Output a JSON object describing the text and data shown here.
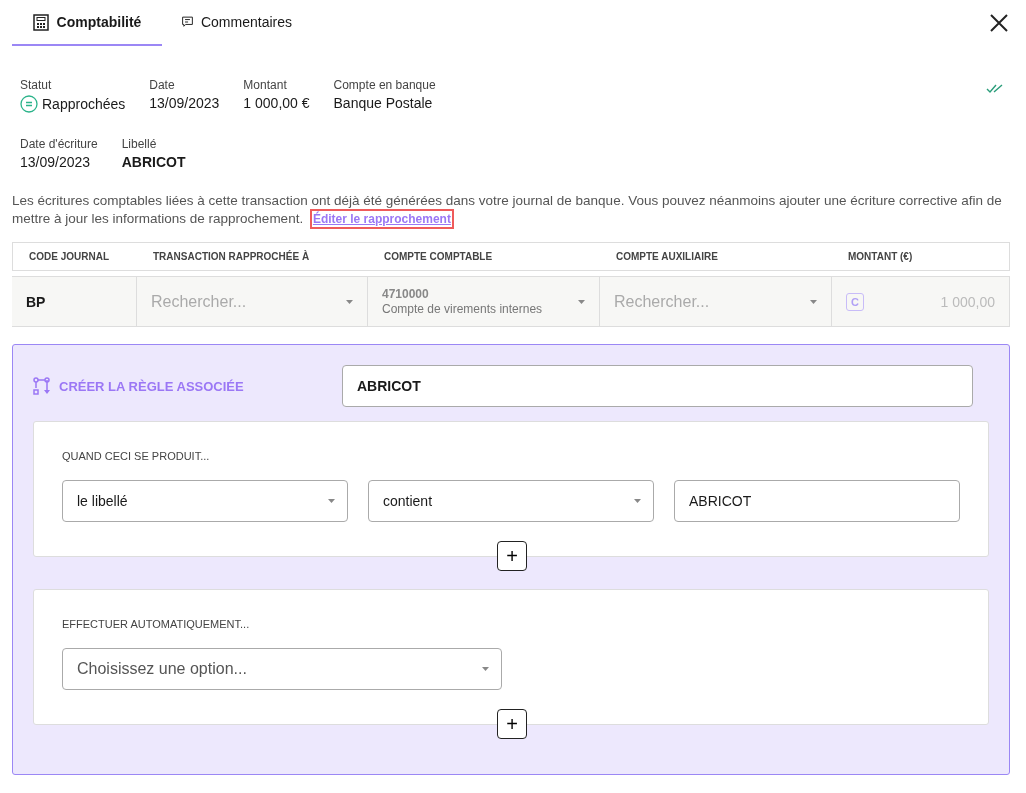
{
  "tabs": [
    {
      "label": "Comptabilité",
      "kind": "calculator",
      "selected": true
    },
    {
      "label": "Commentaires",
      "kind": "comment",
      "selected": false
    }
  ],
  "info_rows": [
    [
      {
        "label": "Statut",
        "value": "Rapprochées",
        "kind": "status"
      },
      {
        "label": "Date",
        "value": "13/09/2023",
        "kind": "text"
      },
      {
        "label": "Montant",
        "value": "1 000,00 €",
        "kind": "text"
      },
      {
        "label": "Compte en banque",
        "value": "Banque Postale",
        "kind": "text"
      }
    ],
    [
      {
        "label": "Date d'écriture",
        "value": "13/09/2023",
        "kind": "text"
      },
      {
        "label": "Libellé",
        "value": "ABRICOT",
        "kind": "bold"
      }
    ]
  ],
  "notice": {
    "text": "Les écritures comptables liées à cette transaction ont déjà été générées dans votre journal de banque. Vous pouvez néanmoins ajouter une écriture corrective afin de mettre à jour les informations de rapprochement.",
    "link": "Éditer le rapprochement"
  },
  "table": {
    "columns": [
      "CODE JOURNAL",
      "TRANSACTION RAPPROCHÉE À",
      "COMPTE COMPTABLE",
      "COMPTE AUXILIAIRE",
      "MONTANT (€)"
    ],
    "row": [
      {
        "kind": "code",
        "value": "BP"
      },
      {
        "kind": "select",
        "placeholder": "Rechercher..."
      },
      {
        "kind": "account",
        "value": "4710000",
        "sub": "Compte de virements internes"
      },
      {
        "kind": "select",
        "placeholder": "Rechercher..."
      },
      {
        "kind": "amount",
        "badge": "C",
        "value": "1 000,00"
      }
    ]
  },
  "rule": {
    "title": "CRÉER LA RÈGLE ASSOCIÉE",
    "name": "ABRICOT",
    "condition": {
      "heading": "QUAND CECI SE PRODUIT...",
      "fields": [
        {
          "kind": "select",
          "value": "le libellé"
        },
        {
          "kind": "select",
          "value": "contient"
        },
        {
          "kind": "input",
          "value": "ABRICOT"
        }
      ],
      "add": "+"
    },
    "action": {
      "heading": "EFFECTUER AUTOMATIQUEMENT...",
      "fields": [
        {
          "kind": "select",
          "placeholder": "Choisissez une option..."
        }
      ],
      "add": "+"
    }
  }
}
